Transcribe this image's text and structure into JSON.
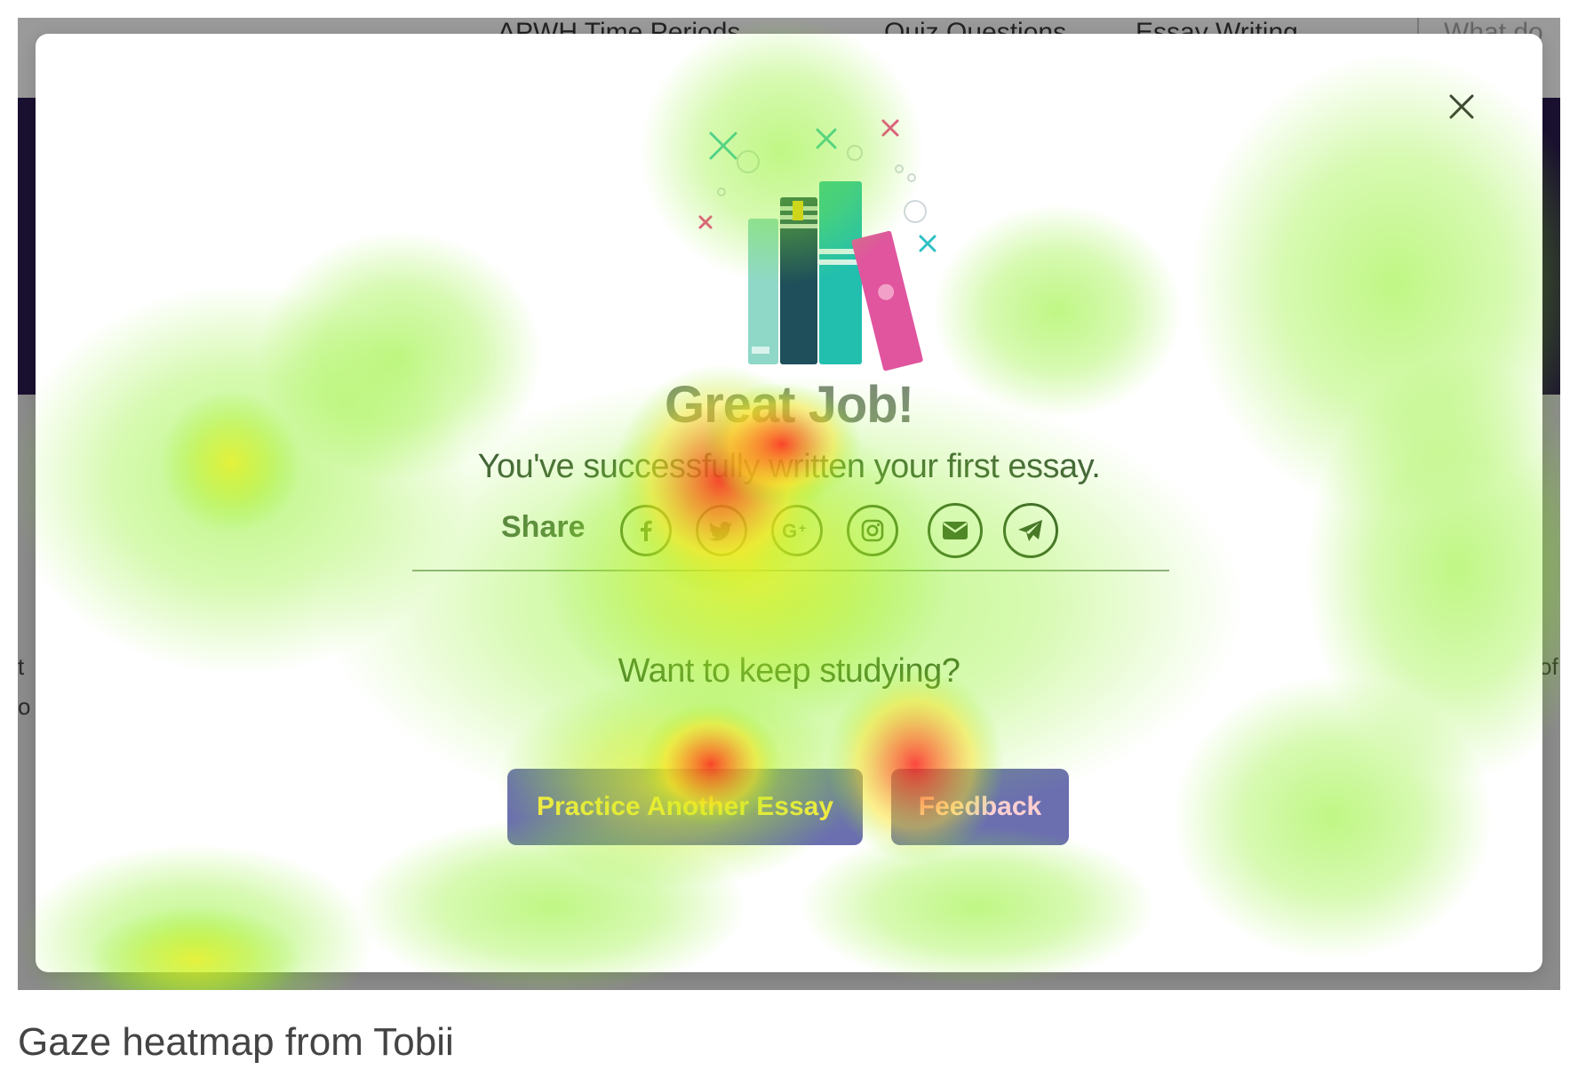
{
  "page": {
    "nav": {
      "periods": "APWH Time Periods",
      "quiz": "Quiz Questions",
      "essay": "Essay Writing",
      "what": "What do"
    },
    "left_frag_1": "t",
    "left_frag_2": "o",
    "right_frag": "of"
  },
  "modal": {
    "title": "Great Job!",
    "subtitle": "You've successfully written your first essay.",
    "share_label": "Share",
    "share_icons": [
      "facebook-icon",
      "twitter-icon",
      "google-plus-icon",
      "instagram-icon",
      "email-icon",
      "telegram-icon"
    ],
    "prompt": "Want to keep studying?",
    "buttons": {
      "practice": "Practice Another Essay",
      "feedback": "Feedback"
    }
  },
  "caption": "Gaze heatmap from Tobii",
  "colors": {
    "button_bg": "#6b6fb0",
    "heat_hot": "#ff2a1a",
    "heat_warm": "#ffe21a",
    "heat_cool": "#7cf21a"
  }
}
